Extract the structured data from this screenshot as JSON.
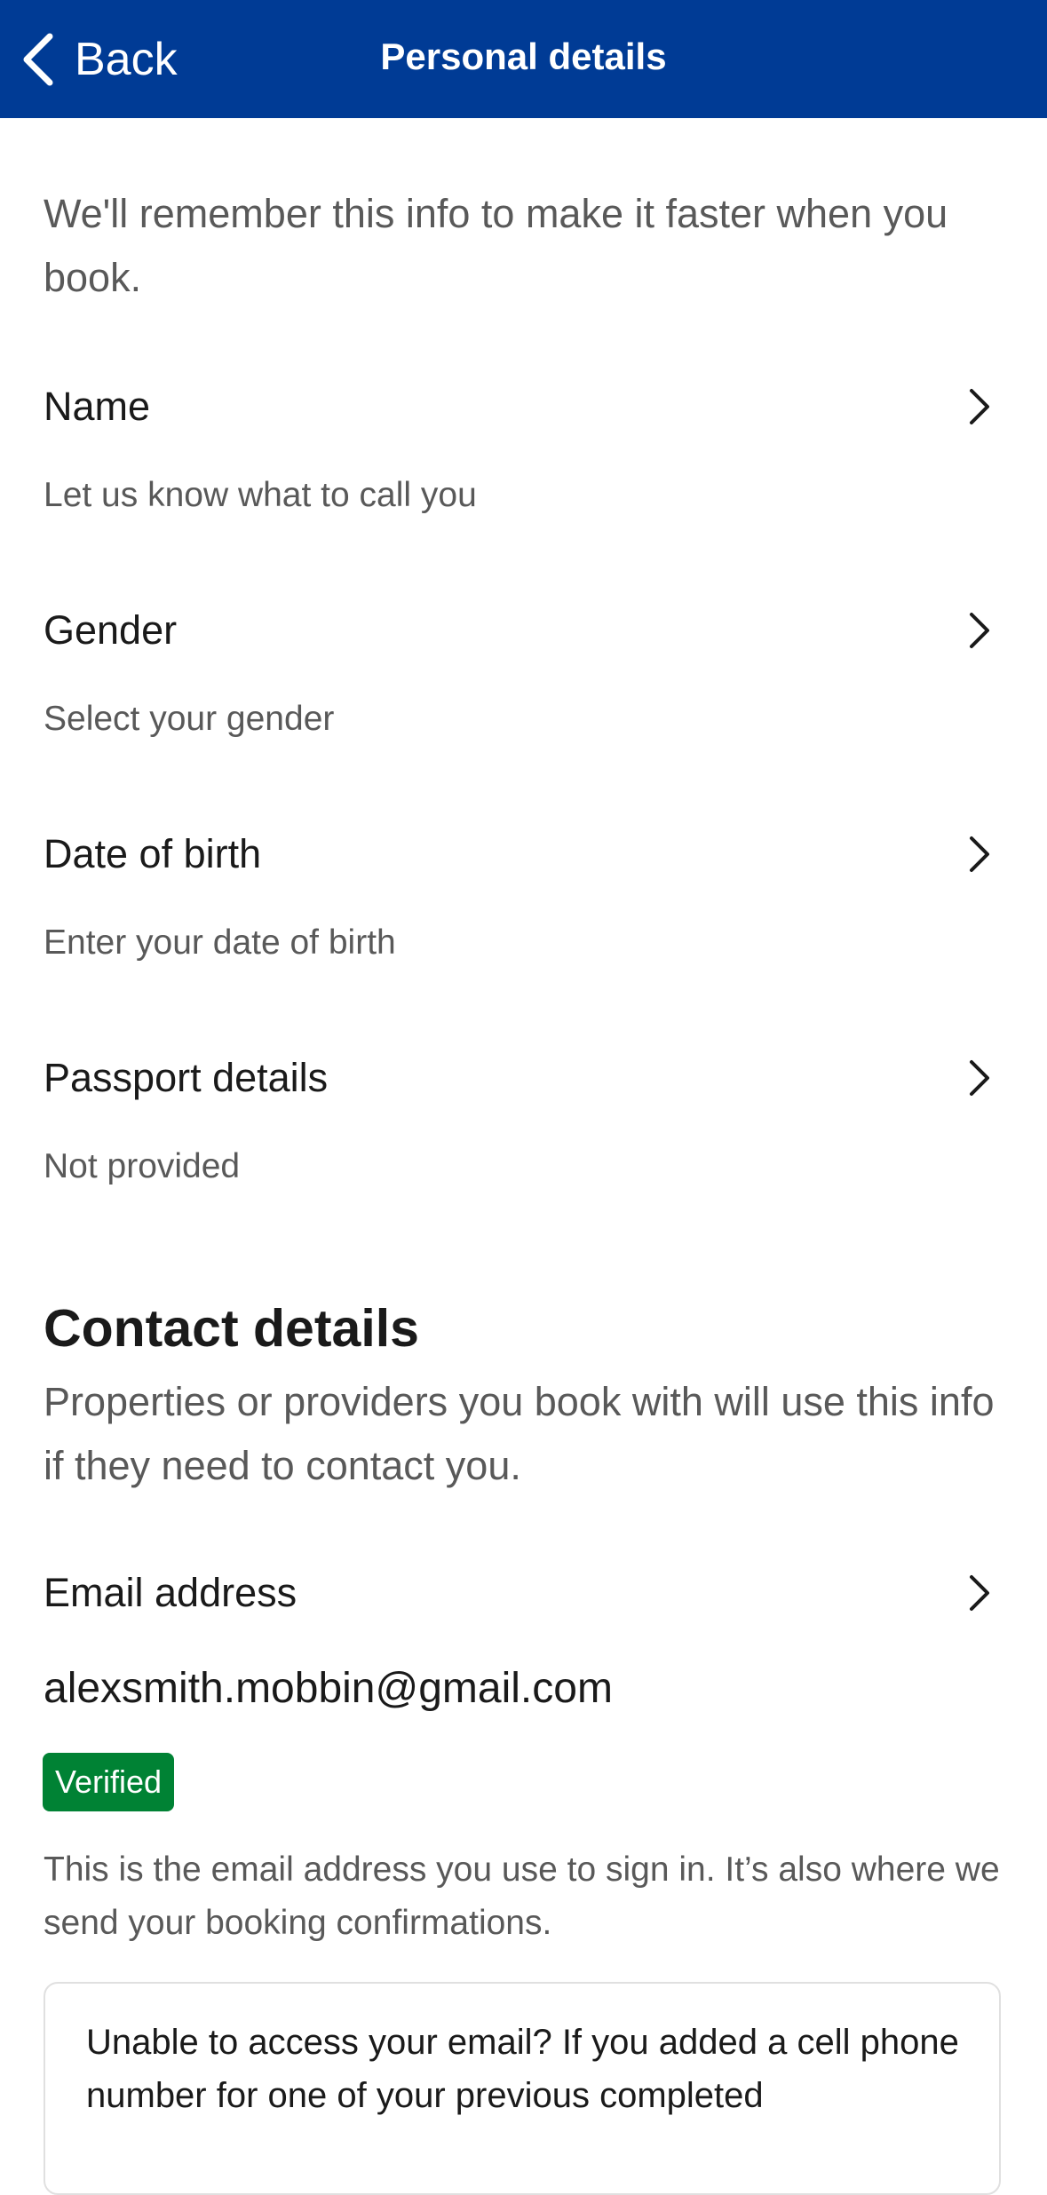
{
  "header": {
    "back_label": "Back",
    "title": "Personal details",
    "background_color": "#003b95"
  },
  "intro": "We'll remember this info to make it faster when you book.",
  "items": [
    {
      "title": "Name",
      "subtitle": "Let us know what to call you",
      "icon": "chevron-right-icon"
    },
    {
      "title": "Gender",
      "subtitle": "Select your gender",
      "icon": "chevron-right-icon"
    },
    {
      "title": "Date of birth",
      "subtitle": "Enter your date of birth",
      "icon": "chevron-right-icon"
    },
    {
      "title": "Passport details",
      "subtitle": "Not provided",
      "icon": "chevron-right-icon"
    }
  ],
  "contact": {
    "heading": "Contact details",
    "description": "Properties or providers you book with will use this info if they need to contact you.",
    "email_label": "Email address",
    "email_value": "alexsmith.mobbin@gmail.com",
    "badge": "Verified",
    "badge_color": "#008234",
    "note": "This is the email address you use to sign in. It’s also where we send your booking confirmations.",
    "info_box": "Unable to access your email? If you added a cell phone number for one of your previous completed"
  }
}
